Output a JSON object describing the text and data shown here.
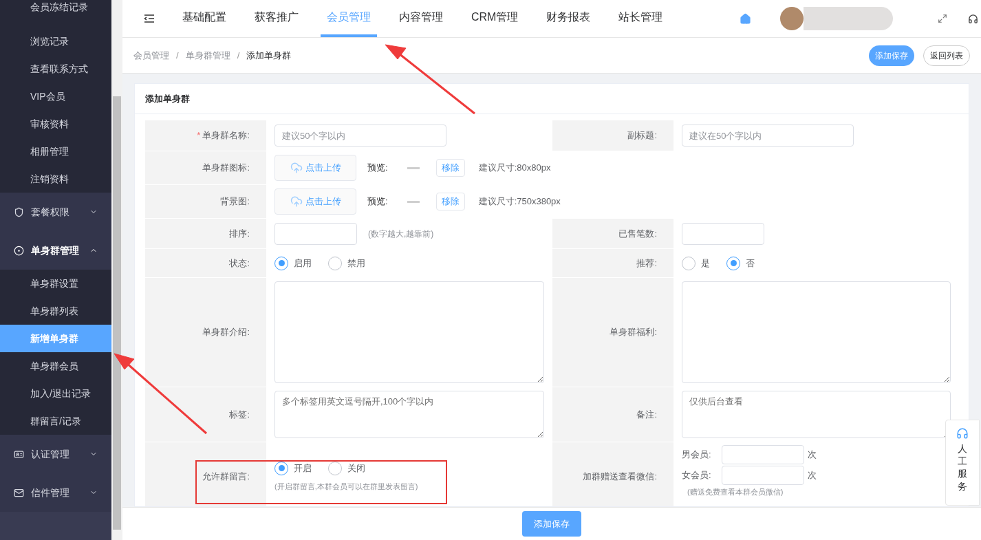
{
  "sidebar": {
    "items": [
      {
        "kind": "sub",
        "label": "会员冻结记录",
        "selected": false
      },
      {
        "kind": "sub",
        "label": "浏览记录",
        "selected": false
      },
      {
        "kind": "sub",
        "label": "查看联系方式",
        "selected": false
      },
      {
        "kind": "sub",
        "label": "VIP会员",
        "selected": false
      },
      {
        "kind": "sub",
        "label": "审核资料",
        "selected": false
      },
      {
        "kind": "sub",
        "label": "相册管理",
        "selected": false
      },
      {
        "kind": "sub",
        "label": "注销资料",
        "selected": false
      },
      {
        "kind": "group",
        "label": "套餐权限",
        "expanded": false
      },
      {
        "kind": "group",
        "label": "单身群管理",
        "expanded": true,
        "children": [
          {
            "label": "单身群设置",
            "selected": false
          },
          {
            "label": "单身群列表",
            "selected": false
          },
          {
            "label": "新增单身群",
            "selected": true
          },
          {
            "label": "单身群会员",
            "selected": false
          },
          {
            "label": "加入/退出记录",
            "selected": false
          },
          {
            "label": "群留言/记录",
            "selected": false
          }
        ]
      },
      {
        "kind": "group",
        "label": "认证管理",
        "expanded": false
      },
      {
        "kind": "group",
        "label": "信件管理",
        "expanded": false
      }
    ]
  },
  "nav": {
    "tabs": [
      {
        "label": "基础配置",
        "selected": false
      },
      {
        "label": "获客推广",
        "selected": false
      },
      {
        "label": "会员管理",
        "selected": true
      },
      {
        "label": "内容管理",
        "selected": false
      },
      {
        "label": "CRM管理",
        "selected": false
      },
      {
        "label": "财务报表",
        "selected": false
      },
      {
        "label": "站长管理",
        "selected": false
      }
    ]
  },
  "breadcrumb": {
    "separator": "/",
    "items": [
      "会员管理",
      "单身群管理",
      "添加单身群"
    ]
  },
  "header_buttons": [
    {
      "label": "添加保存",
      "kind": "primary"
    },
    {
      "label": "返回列表",
      "kind": "default"
    }
  ],
  "card_title": "添加单身群",
  "form_rows": [
    {
      "fields": [
        {
          "label": "单身群名称:",
          "required_mark": "*",
          "kind": "text",
          "placeholder": "建议50个字以内"
        },
        {
          "label": "副标题:",
          "kind": "text",
          "placeholder": "建议在50个字以内"
        }
      ]
    },
    {
      "fields": [
        {
          "label": "单身群图标:",
          "kind": "upload",
          "button": "点击上传",
          "preview": "预览:",
          "remove": "移除",
          "hint": "建议尺寸:80x80px"
        }
      ]
    },
    {
      "fields": [
        {
          "label": "背景图:",
          "kind": "upload",
          "button": "点击上传",
          "preview": "预览:",
          "remove": "移除",
          "hint": "建议尺寸:750x380px"
        }
      ]
    },
    {
      "fields": [
        {
          "label": "排序:",
          "kind": "number",
          "hint": "(数字越大,越靠前)"
        },
        {
          "label": "已售笔数:",
          "kind": "number"
        }
      ]
    },
    {
      "fields": [
        {
          "label": "状态:",
          "kind": "radio",
          "options": [
            {
              "label": "启用",
              "selected": true
            },
            {
              "label": "禁用",
              "selected": false
            }
          ]
        },
        {
          "label": "推荐:",
          "kind": "radio",
          "options": [
            {
              "label": "是",
              "selected": false
            },
            {
              "label": "否",
              "selected": true
            }
          ]
        }
      ]
    },
    {
      "fields": [
        {
          "label": "单身群介绍:",
          "kind": "textarea"
        },
        {
          "label": "单身群福利:",
          "kind": "textarea"
        }
      ]
    },
    {
      "fields": [
        {
          "label": "标签:",
          "kind": "textarea",
          "placeholder": "多个标签用英文逗号隔开,100个字以内"
        },
        {
          "label": "备注:",
          "kind": "textarea",
          "placeholder": "仅供后台查看"
        }
      ]
    },
    {
      "fields": [
        {
          "label": "允许群留言:",
          "kind": "radio",
          "note": "(开启群留言,本群会员可以在群里发表留言)",
          "options": [
            {
              "label": "开启",
              "selected": true
            },
            {
              "label": "关闭",
              "selected": false
            }
          ]
        },
        {
          "label": "加群赠送查看微信:",
          "kind": "counts",
          "counts": [
            {
              "label": "男会员:",
              "unit": "次"
            },
            {
              "label": "女会员:",
              "unit": "次"
            }
          ],
          "note": "(赠送免费查看本群会员微信)"
        }
      ]
    }
  ],
  "footer_button": "添加保存",
  "service_widget": "人工服务"
}
